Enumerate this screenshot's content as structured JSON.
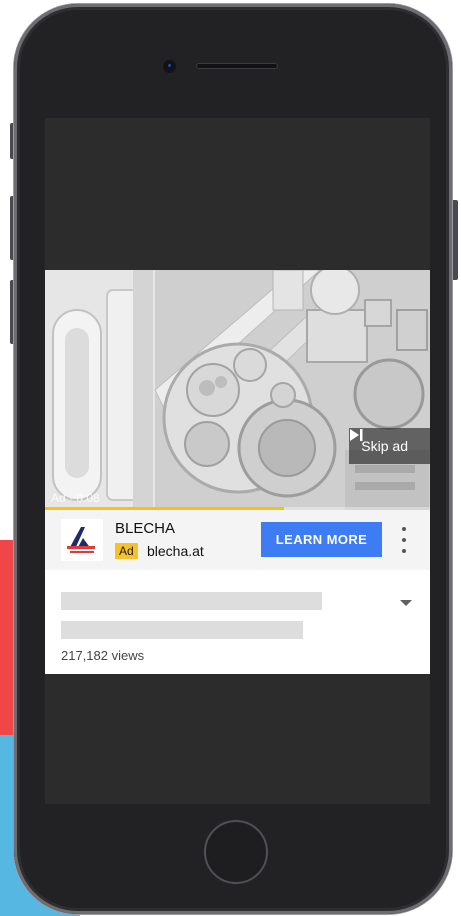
{
  "ad": {
    "skip_label": "Skip ad",
    "timer": "Ad · 0:08",
    "progress": 0.62,
    "advertiser": "BLECHA",
    "badge": "Ad",
    "domain": "blecha.at",
    "cta": "LEARN MORE"
  },
  "video_info": {
    "views": "217,182 views"
  },
  "colors": {
    "cta_blue": "#3d7cf2",
    "ad_badge_yellow": "#f7c229",
    "progress_yellow": "#f6c21a",
    "background_red": "#ef4747",
    "background_blue": "#55b7e2"
  },
  "icons": [
    "skip-forward-icon",
    "more-vert-icon",
    "chevron-down-icon",
    "blecha-logo"
  ]
}
